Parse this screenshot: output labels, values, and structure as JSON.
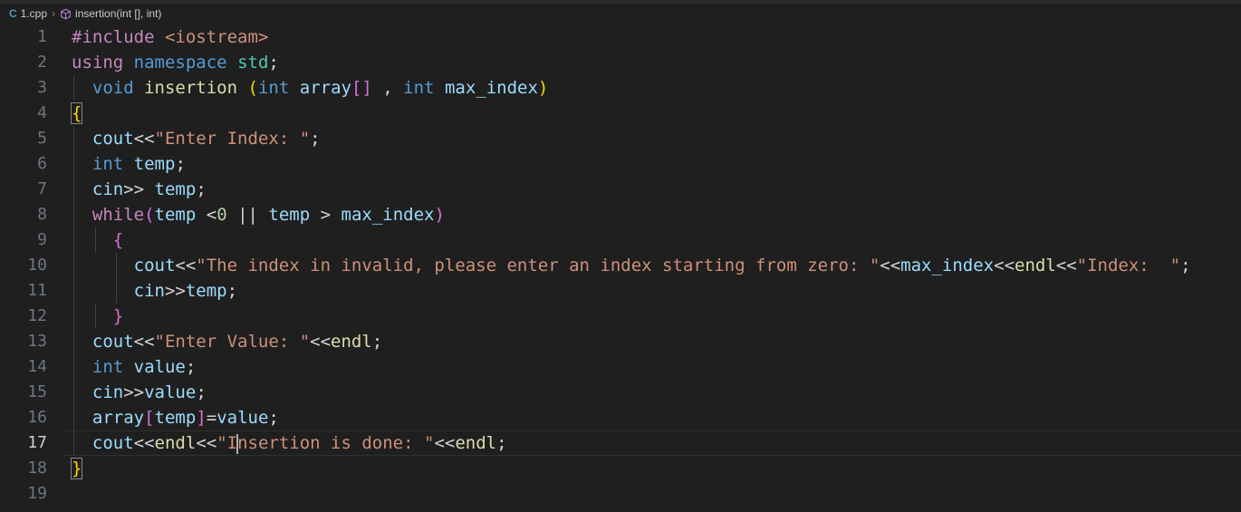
{
  "breadcrumb": {
    "file_icon": "cpp-file-icon",
    "file": "1.cpp",
    "separator": "›",
    "symbol_icon": "method-cube-icon",
    "symbol": "insertion(int [], int)"
  },
  "editor": {
    "current_line": 17,
    "lines": [
      {
        "n": "1",
        "tokens": [
          [
            "kw",
            "#include"
          ],
          [
            "op",
            " "
          ],
          [
            "str",
            "<iostream>"
          ]
        ]
      },
      {
        "n": "2",
        "tokens": [
          [
            "kw",
            "using"
          ],
          [
            "op",
            " "
          ],
          [
            "kw2",
            "namespace"
          ],
          [
            "op",
            " "
          ],
          [
            "ns",
            "std"
          ],
          [
            "op",
            ";"
          ]
        ]
      },
      {
        "n": "3",
        "tokens": [
          [
            "op",
            "  "
          ],
          [
            "kw2",
            "void"
          ],
          [
            "op",
            " "
          ],
          [
            "fn",
            "insertion"
          ],
          [
            "op",
            " "
          ],
          [
            "br1",
            "("
          ],
          [
            "kw2",
            "int"
          ],
          [
            "op",
            " "
          ],
          [
            "var",
            "array"
          ],
          [
            "br2",
            "[]"
          ],
          [
            "op",
            " , "
          ],
          [
            "kw2",
            "int"
          ],
          [
            "op",
            " "
          ],
          [
            "var",
            "max_index"
          ],
          [
            "br1",
            ")"
          ]
        ]
      },
      {
        "n": "4",
        "tokens": [
          [
            "br1",
            "{"
          ]
        ]
      },
      {
        "n": "5",
        "tokens": [
          [
            "op",
            "  "
          ],
          [
            "var",
            "cout"
          ],
          [
            "op",
            "<<"
          ],
          [
            "str",
            "\"Enter Index: \""
          ],
          [
            "op",
            ";"
          ]
        ]
      },
      {
        "n": "6",
        "tokens": [
          [
            "op",
            "  "
          ],
          [
            "kw2",
            "int"
          ],
          [
            "op",
            " "
          ],
          [
            "var",
            "temp"
          ],
          [
            "op",
            ";"
          ]
        ]
      },
      {
        "n": "7",
        "tokens": [
          [
            "op",
            "  "
          ],
          [
            "var",
            "cin"
          ],
          [
            "op",
            ">> "
          ],
          [
            "var",
            "temp"
          ],
          [
            "op",
            ";"
          ]
        ]
      },
      {
        "n": "8",
        "tokens": [
          [
            "op",
            "  "
          ],
          [
            "kw",
            "while"
          ],
          [
            "br2",
            "("
          ],
          [
            "var",
            "temp"
          ],
          [
            "op",
            " <"
          ],
          [
            "num",
            "0"
          ],
          [
            "op",
            " || "
          ],
          [
            "var",
            "temp"
          ],
          [
            "op",
            " > "
          ],
          [
            "var",
            "max_index"
          ],
          [
            "br2",
            ")"
          ]
        ]
      },
      {
        "n": "9",
        "tokens": [
          [
            "op",
            "    "
          ],
          [
            "br2",
            "{"
          ]
        ]
      },
      {
        "n": "10",
        "tokens": [
          [
            "op",
            "      "
          ],
          [
            "var",
            "cout"
          ],
          [
            "op",
            "<<"
          ],
          [
            "str",
            "\"The index in invalid, please enter an index starting from zero: \""
          ],
          [
            "op",
            "<<"
          ],
          [
            "var",
            "max_index"
          ],
          [
            "op",
            "<<"
          ],
          [
            "fn",
            "endl"
          ],
          [
            "op",
            "<<"
          ],
          [
            "str",
            "\"Index:  \""
          ],
          [
            "op",
            ";"
          ]
        ]
      },
      {
        "n": "11",
        "tokens": [
          [
            "op",
            "      "
          ],
          [
            "var",
            "cin"
          ],
          [
            "op",
            ">>"
          ],
          [
            "var",
            "temp"
          ],
          [
            "op",
            ";"
          ]
        ]
      },
      {
        "n": "12",
        "tokens": [
          [
            "op",
            "    "
          ],
          [
            "br2",
            "}"
          ]
        ]
      },
      {
        "n": "13",
        "tokens": [
          [
            "op",
            "  "
          ],
          [
            "var",
            "cout"
          ],
          [
            "op",
            "<<"
          ],
          [
            "str",
            "\"Enter Value: \""
          ],
          [
            "op",
            "<<"
          ],
          [
            "fn",
            "endl"
          ],
          [
            "op",
            ";"
          ]
        ]
      },
      {
        "n": "14",
        "tokens": [
          [
            "op",
            "  "
          ],
          [
            "kw2",
            "int"
          ],
          [
            "op",
            " "
          ],
          [
            "var",
            "value"
          ],
          [
            "op",
            ";"
          ]
        ]
      },
      {
        "n": "15",
        "tokens": [
          [
            "op",
            "  "
          ],
          [
            "var",
            "cin"
          ],
          [
            "op",
            ">>"
          ],
          [
            "var",
            "value"
          ],
          [
            "op",
            ";"
          ]
        ]
      },
      {
        "n": "16",
        "tokens": [
          [
            "op",
            "  "
          ],
          [
            "var",
            "array"
          ],
          [
            "br2",
            "["
          ],
          [
            "var",
            "temp"
          ],
          [
            "br2",
            "]"
          ],
          [
            "op",
            "="
          ],
          [
            "var",
            "value"
          ],
          [
            "op",
            ";"
          ]
        ]
      },
      {
        "n": "17",
        "tokens": [
          [
            "op",
            "  "
          ],
          [
            "var",
            "cout"
          ],
          [
            "op",
            "<<"
          ],
          [
            "fn",
            "endl"
          ],
          [
            "op",
            "<<"
          ],
          [
            "str",
            "\"I"
          ],
          [
            "cursor",
            ""
          ],
          [
            "str",
            "nsertion is done: \""
          ],
          [
            "op",
            "<<"
          ],
          [
            "fn",
            "endl"
          ],
          [
            "op",
            ";"
          ]
        ]
      },
      {
        "n": "18",
        "tokens": [
          [
            "br1",
            "}"
          ]
        ]
      },
      {
        "n": "19",
        "tokens": []
      }
    ]
  }
}
